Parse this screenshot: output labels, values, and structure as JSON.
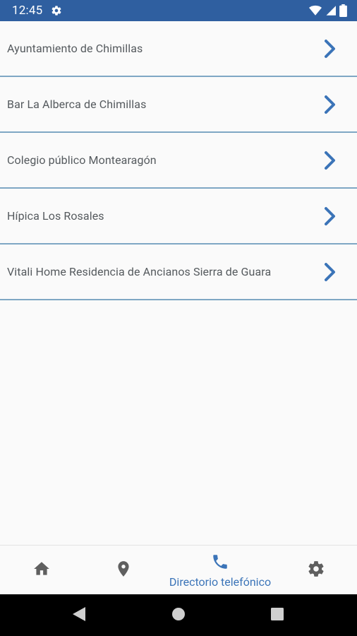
{
  "status_bar": {
    "time": "12:45",
    "icons": [
      "settings-icon",
      "wifi-icon",
      "signal-icon",
      "battery-icon"
    ]
  },
  "directory": {
    "items": [
      {
        "label": "Ayuntamiento de Chimillas"
      },
      {
        "label": "Bar La Alberca de Chimillas"
      },
      {
        "label": "Colegio público Montearagón"
      },
      {
        "label": "Hípica Los Rosales"
      },
      {
        "label": "Vitali Home Residencia de Ancianos Sierra de Guara"
      }
    ]
  },
  "bottom_nav": {
    "items": [
      {
        "icon": "home-icon",
        "label": ""
      },
      {
        "icon": "location-pin-icon",
        "label": ""
      },
      {
        "icon": "phone-icon",
        "label": "Directorio telefónico",
        "active": true
      },
      {
        "icon": "gear-icon",
        "label": ""
      }
    ]
  },
  "colors": {
    "status_bar": "#2f5fa0",
    "accent": "#3b74b8",
    "divider": "#7fa7c4",
    "text": "#555a5e",
    "background": "#fafafa"
  }
}
